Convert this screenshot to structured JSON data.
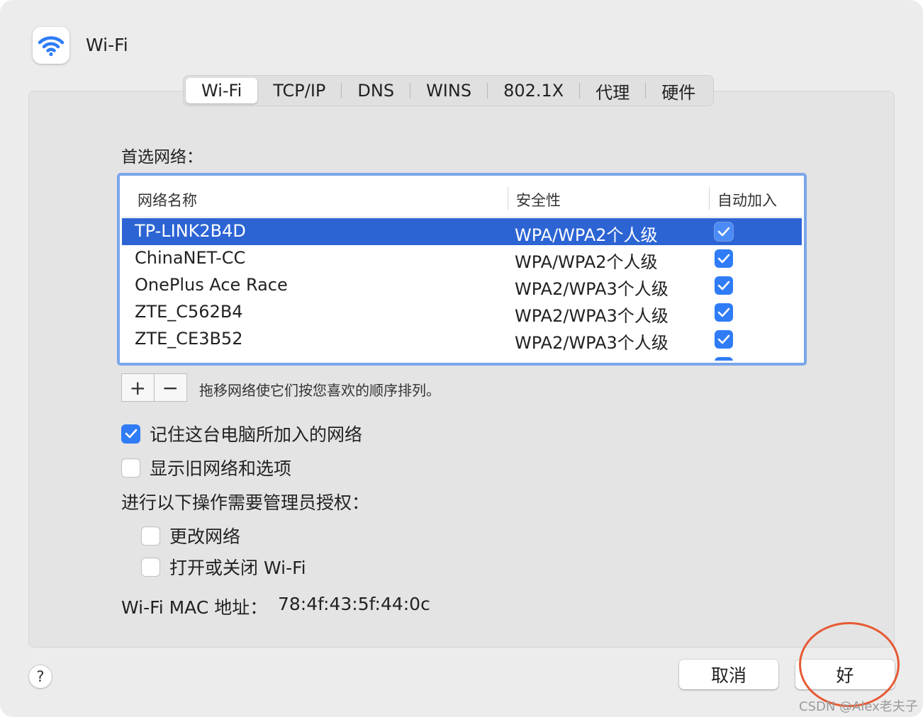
{
  "header": {
    "title": "Wi-Fi",
    "icon": "wifi-icon"
  },
  "tabs": [
    {
      "label": "Wi-Fi",
      "active": true
    },
    {
      "label": "TCP/IP",
      "active": false
    },
    {
      "label": "DNS",
      "active": false
    },
    {
      "label": "WINS",
      "active": false
    },
    {
      "label": "802.1X",
      "active": false
    },
    {
      "label": "代理",
      "active": false
    },
    {
      "label": "硬件",
      "active": false
    }
  ],
  "preferred": {
    "label": "首选网络：",
    "columns": {
      "name": "网络名称",
      "security": "安全性",
      "auto_join": "自动加入"
    },
    "rows": [
      {
        "name": "TP-LINK2B4D",
        "security": "WPA/WPA2个人级",
        "auto_join": true,
        "selected": true
      },
      {
        "name": "ChinaNET-CC",
        "security": "WPA/WPA2个人级",
        "auto_join": true,
        "selected": false
      },
      {
        "name": "OnePlus Ace Race",
        "security": "WPA2/WPA3个人级",
        "auto_join": true,
        "selected": false
      },
      {
        "name": "ZTE_C562B4",
        "security": "WPA2/WPA3个人级",
        "auto_join": true,
        "selected": false
      },
      {
        "name": "ZTE_CE3B52",
        "security": "WPA2/WPA3个人级",
        "auto_join": true,
        "selected": false
      }
    ],
    "add_label": "+",
    "remove_label": "−",
    "hint": "拖移网络使它们按您喜欢的顺序排列。"
  },
  "options": {
    "remember": {
      "label": "记住这台电脑所加入的网络",
      "checked": true
    },
    "legacy": {
      "label": "显示旧网络和选项",
      "checked": false
    },
    "admin_label": "进行以下操作需要管理员授权：",
    "change_networks": {
      "label": "更改网络",
      "checked": false
    },
    "toggle_wifi": {
      "label": "打开或关闭 Wi-Fi",
      "checked": false
    }
  },
  "mac": {
    "label": "Wi-Fi MAC 地址：",
    "value": "78:4f:43:5f:44:0c"
  },
  "footer": {
    "help": "?",
    "cancel": "取消",
    "ok": "好"
  },
  "watermark": "CSDN @Alex老夫子",
  "colors": {
    "accent": "#2f7cf6",
    "selection": "#2c64d4",
    "focus_ring": "#7aa6ea",
    "annotation": "#e65a34"
  }
}
